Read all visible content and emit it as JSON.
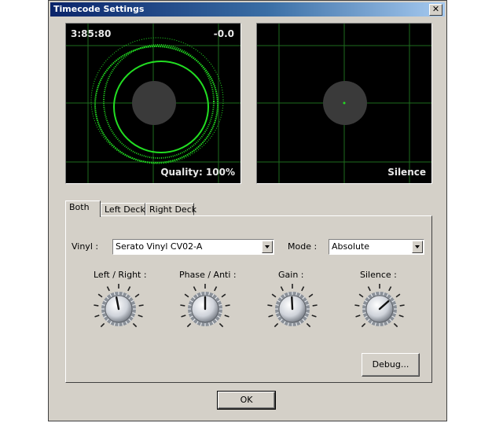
{
  "window": {
    "title": "Timecode Settings",
    "close_symbol": "✕"
  },
  "scopes": {
    "left": {
      "time": "3:85:80",
      "offset": "-0.0",
      "status": "Quality: 100%"
    },
    "right": {
      "status": "Silence"
    }
  },
  "tabs": [
    "Both",
    "Left Deck",
    "Right Deck"
  ],
  "active_tab": "Both",
  "vinyl": {
    "label": "Vinyl :",
    "value": "Serato Vinyl CV02-A"
  },
  "mode": {
    "label": "Mode :",
    "value": "Absolute"
  },
  "knobs": [
    {
      "label": "Left / Right :",
      "level": 0.46
    },
    {
      "label": "Phase / Anti :",
      "level": 0.5
    },
    {
      "label": "Gain :",
      "level": 0.49
    },
    {
      "label": "Silence :",
      "level": 0.68
    }
  ],
  "buttons": {
    "debug": "Debug...",
    "ok": "OK"
  },
  "colors": {
    "scope_trace": "#22dd22",
    "scope_grid": "#1e6b1e",
    "title_bar": "#0a246a",
    "dialog_bg": "#d4d0c8"
  }
}
